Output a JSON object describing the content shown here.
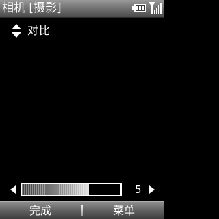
{
  "titlebar": {
    "title": "相机 [摄影]",
    "icons": [
      "battery-icon",
      "signal-icon"
    ]
  },
  "setting": {
    "label": "对比",
    "icon": "up-down-arrows-icon"
  },
  "slider": {
    "value": "5",
    "level_fraction": 0.68
  },
  "softkeys": {
    "left": "完成",
    "right": "菜单"
  },
  "colors": {
    "background": "#000000",
    "bar_gray": "#6c6c6c",
    "text": "#ffffff"
  }
}
